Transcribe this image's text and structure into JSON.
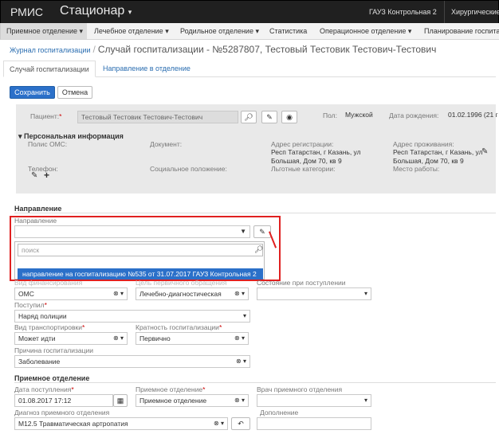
{
  "topbar": {
    "brand": "РМИС",
    "module": "Стационар",
    "org": "ГАУЗ Контрольная 2",
    "dept": "Хирургические"
  },
  "menu": [
    "Приемное отделение",
    "Лечебное отделение",
    "Родильное отделение",
    "Статистика",
    "Операционное отделение",
    "Планирование госпитал"
  ],
  "breadcrumb": {
    "link": "Журнал госпитализации",
    "sep": "/",
    "title": "Случай госпитализации - №5287807, Тестовый Тестовик Тестович-Тестович"
  },
  "tabs": [
    "Случай госпитализации",
    "Направление в отделение"
  ],
  "actions": {
    "save": "Сохранить",
    "cancel": "Отмена"
  },
  "patient": {
    "label": "Пациент:",
    "value": "Тестовый Тестовик Тестович-Тестович",
    "sex_label": "Пол:",
    "sex": "Мужской",
    "dob_label": "Дата рождения:",
    "dob": "01.02.1996 (21 г",
    "personal_title": "Персональная информация",
    "oms_label": "Полис ОМС:",
    "doc_label": "Документ:",
    "reg_label": "Адрес регистрации:",
    "reg": "Респ Татарстан, г Казань, ул Большая, Дом 70, кв 9",
    "live_label": "Адрес проживания:",
    "live": "Респ Татарстан, г Казань, ул Большая, Дом 70, кв 9",
    "phone_label": "Телефон:",
    "social_label": "Социальное положение:",
    "benefit_label": "Льготные категории:",
    "work_label": "Место работы:"
  },
  "direction": {
    "section": "Направление",
    "label": "Направление",
    "search_placeholder": "поиск",
    "option": "направление на госпитализацию №535 от 31.07.2017 ГАУЗ Контрольная 2"
  },
  "hospitalization": {
    "finance_label": "Вид финансирования",
    "finance": "ОМС",
    "goal_label": "Цель первичного обращения",
    "goal": "Лечебно-диагностическая",
    "state_label": "Состояние при поступлении",
    "arrived_label": "Поступил",
    "arrived": "Наряд полиции",
    "transport_label": "Вид транспортировки",
    "transport": "Может идти",
    "multiplicity_label": "Кратность госпитализации",
    "multiplicity": "Первично",
    "reason_label": "Причина госпитализации",
    "reason": "Заболевание"
  },
  "admission": {
    "section": "Приемное отделение",
    "date_label": "Дата поступления",
    "date": "01.08.2017 17:12",
    "dept_label": "Приемное отделение",
    "dept": "Приемное отделение",
    "doctor_label": "Врач приемного отделения",
    "diag_label": "Диагноз приемного отделения",
    "diag": "M12.5 Травматическая артропатия",
    "extra_label": "Дополнение"
  },
  "colors": {
    "accent": "#2b70c9",
    "highlight": "#e02020",
    "topbar": "#202020"
  }
}
